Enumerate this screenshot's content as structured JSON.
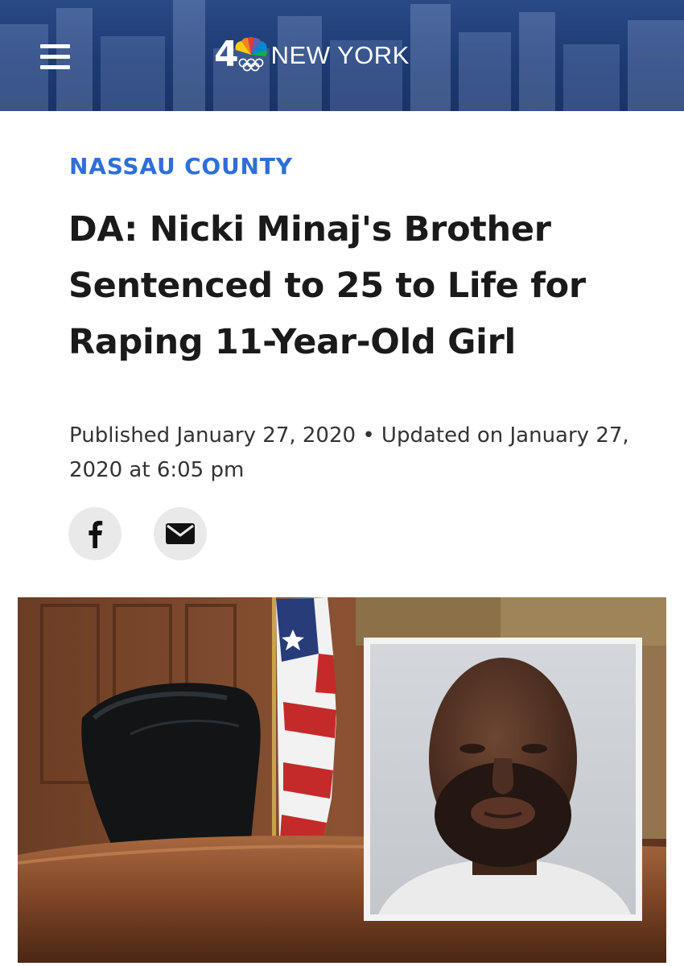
{
  "header": {
    "logo_number": "4",
    "logo_text": "NEW YORK",
    "menu_icon": "hamburger-menu-icon",
    "logo_icon": "nbc-peacock-icon"
  },
  "article": {
    "category": "NASSAU COUNTY",
    "headline": "DA: Nicki Minaj's Brother Sentenced to 25 to Life for Raping 11-Year-Old Girl",
    "published": "Published January 27, 2020 • Updated on January 27, 2020 at 6:05 pm"
  },
  "share": {
    "facebook_icon": "facebook-icon",
    "email_icon": "email-icon"
  },
  "colors": {
    "header_bg": "#1d3a73",
    "category": "#2f6fd6",
    "headline": "#1a1a1a",
    "byline": "#333333",
    "share_button_bg": "#e9e9e9"
  }
}
